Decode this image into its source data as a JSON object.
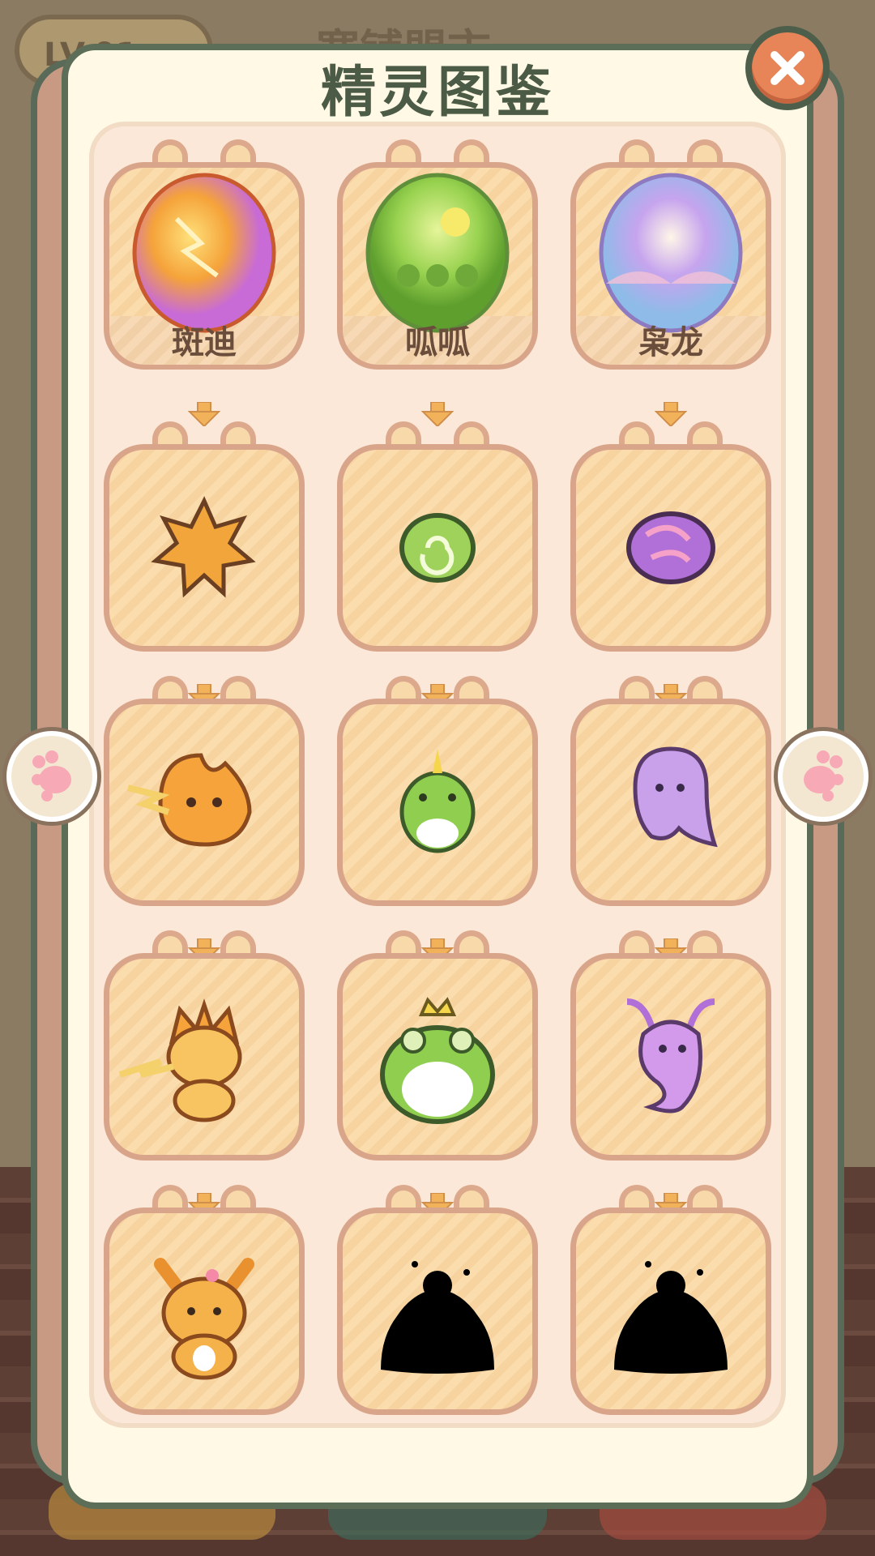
{
  "background": {
    "chip_text": "LV.01",
    "title_text": "寒铺盟市"
  },
  "panel": {
    "title": "精灵图鉴",
    "close_label": "close-icon"
  },
  "colors": {
    "panel_bg": "#fff9e6",
    "panel_border": "#5c6d58",
    "card_fill": "#fbdcad",
    "card_border": "#d9a58a",
    "close_button": "#e88558"
  },
  "columns": [
    {
      "egg_name": "斑迪",
      "egg_icon": "fire-egg-icon",
      "stages": [
        "spiky-star-icon",
        "flame-spirit-icon",
        "fire-cat-icon",
        "fox-spirit-icon"
      ],
      "stage_locked": [
        false,
        false,
        false,
        false
      ]
    },
    {
      "egg_name": "呱呱",
      "egg_icon": "grass-egg-icon",
      "stages": [
        "green-swirl-seed-icon",
        "tadpole-icon",
        "crowned-frog-icon",
        "locked-silhouette-icon"
      ],
      "stage_locked": [
        false,
        false,
        false,
        true
      ]
    },
    {
      "egg_name": "枭龙",
      "egg_icon": "dream-egg-icon",
      "stages": [
        "purple-orb-icon",
        "ghost-spirit-icon",
        "antlered-dragon-icon",
        "locked-silhouette-icon"
      ],
      "stage_locked": [
        false,
        false,
        false,
        true
      ]
    }
  ],
  "navigation": {
    "prev_label": "paw-prev-icon",
    "next_label": "paw-next-icon"
  }
}
